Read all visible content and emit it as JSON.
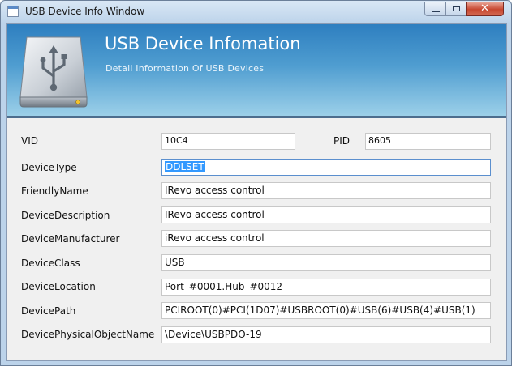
{
  "window": {
    "title": "USB Device Info Window",
    "close_glyph": "✕"
  },
  "banner": {
    "title": "USB Device Infomation",
    "subtitle": "Detail Information Of USB Devices",
    "icon": "usb-drive-icon"
  },
  "fields": {
    "vid": {
      "label": "VID",
      "value": "10C4"
    },
    "pid": {
      "label": "PID",
      "value": "8605"
    },
    "device_type": {
      "label": "DeviceType",
      "value": "DDLSET"
    },
    "friendly_name": {
      "label": "FriendlyName",
      "value": "IRevo access control"
    },
    "device_description": {
      "label": "DeviceDescription",
      "value": "IRevo access control"
    },
    "device_manufacturer": {
      "label": "DeviceManufacturer",
      "value": "iRevo access control"
    },
    "device_class": {
      "label": "DeviceClass",
      "value": "USB"
    },
    "device_location": {
      "label": "DeviceLocation",
      "value": "Port_#0001.Hub_#0012"
    },
    "device_path": {
      "label": "DevicePath",
      "value": "PCIROOT(0)#PCI(1D07)#USBROOT(0)#USB(6)#USB(4)#USB(1)"
    },
    "device_pdo_name": {
      "label": "DevicePhysicalObjectName",
      "value": "\\Device\\USBPDO-19"
    }
  },
  "colors": {
    "banner_top": "#2e7fc0",
    "banner_bottom": "#9cd0e9",
    "selection": "#3399ff"
  }
}
